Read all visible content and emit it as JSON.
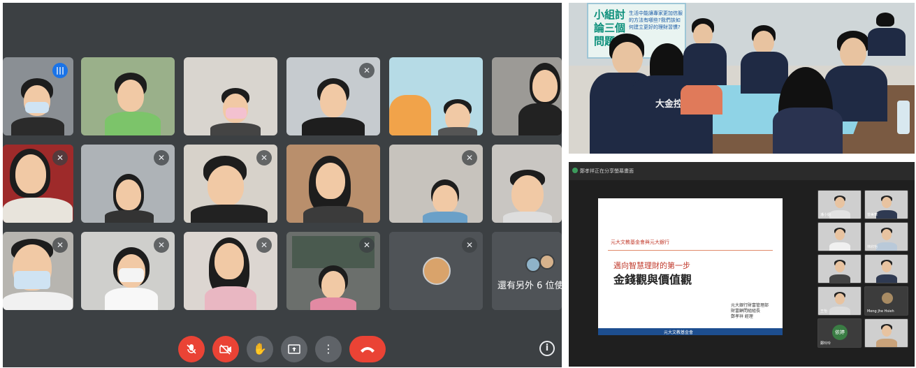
{
  "meet": {
    "tiles": [
      {
        "id": "t1",
        "status": "speaking"
      },
      {
        "id": "t2",
        "status": "none"
      },
      {
        "id": "t3",
        "status": "none"
      },
      {
        "id": "t4",
        "status": "muted"
      },
      {
        "id": "t5",
        "status": "none"
      },
      {
        "id": "t6",
        "status": "none"
      },
      {
        "id": "t7",
        "status": "muted"
      },
      {
        "id": "t8",
        "status": "muted"
      },
      {
        "id": "t9",
        "status": "muted"
      },
      {
        "id": "t10",
        "status": "muted"
      },
      {
        "id": "t11",
        "status": "muted"
      },
      {
        "id": "t12",
        "status": "none"
      },
      {
        "id": "t13",
        "status": "muted"
      },
      {
        "id": "t14",
        "status": "muted"
      },
      {
        "id": "t15",
        "status": "muted"
      },
      {
        "id": "t16",
        "status": "muted"
      },
      {
        "id": "t17",
        "status": "muted"
      },
      {
        "id": "t18",
        "status": "none"
      }
    ],
    "others_label": "還有另外 6 位使",
    "controls": {
      "mic": "mic-off-icon",
      "camera": "camera-off-icon",
      "hand": "raise-hand-icon",
      "present": "present-screen-icon",
      "more": "more-options-icon",
      "end": "end-call-icon",
      "info": "i"
    },
    "colors": {
      "background": "#3c4043",
      "danger": "#ea4335",
      "speaking": "#1a73e8"
    }
  },
  "photo": {
    "board_title": "小組討論三個問題",
    "board_text": "生活中能讓專家更加信服的方法有哪些?我們該如何建立更好的理財習慣?",
    "vest_logo": "大金控"
  },
  "webinar": {
    "window_title": "鄭孝祥正在分享螢幕畫面",
    "slide": {
      "org": "元大文教基金會與元大銀行",
      "subtitle": "邁向智慧理財的第一步",
      "title": "金錢觀與價值觀",
      "presenter_line1": "元大銀行財富管理部",
      "presenter_line2": "財富顧問組組長",
      "presenter_line3": "鄭孝祥 經理",
      "footer": "元大文教基金會"
    },
    "participants": [
      {
        "name": "潘小姐"
      },
      {
        "name": "曾美華"
      },
      {
        "name": ""
      },
      {
        "name": "林欣怡"
      },
      {
        "name": ""
      },
      {
        "name": ""
      },
      {
        "name": "王怡"
      },
      {
        "name": "Meng Jhe Hsieh"
      },
      {
        "name": "鄭玲玲"
      },
      {
        "name": ""
      }
    ],
    "avatar_label": "依婷"
  }
}
